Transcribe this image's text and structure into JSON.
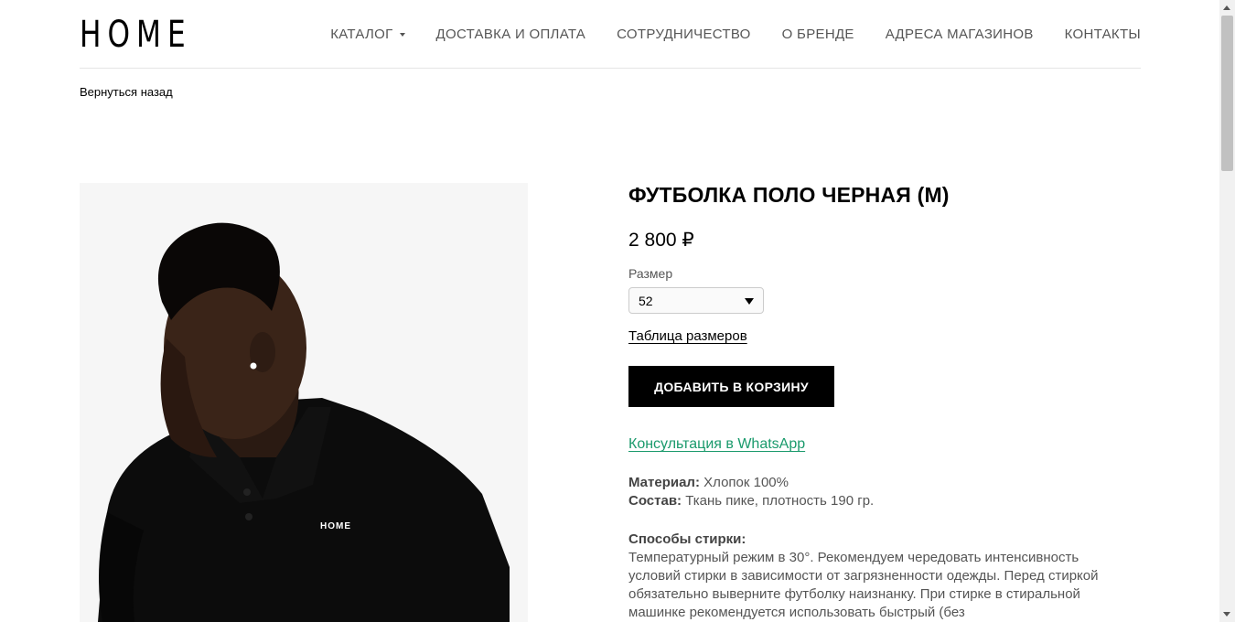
{
  "header": {
    "logo": "HOME",
    "nav": [
      {
        "label": "КАТАЛОГ",
        "has_dropdown": true
      },
      {
        "label": "ДОСТАВКА И ОПЛАТА"
      },
      {
        "label": "СОТРУДНИЧЕСТВО"
      },
      {
        "label": "О БРЕНДЕ"
      },
      {
        "label": "АДРЕСА МАГАЗИНОВ"
      },
      {
        "label": "КОНТАКТЫ"
      }
    ]
  },
  "back_link": "Вернуться назад",
  "product": {
    "title": "ФУТБОЛКА ПОЛО ЧЕРНАЯ (М)",
    "price": "2 800 ₽",
    "size_label": "Размер",
    "size_value": "52",
    "size_table_link": "Таблица размеров",
    "add_to_cart": "ДОБАВИТЬ В КОРЗИНУ",
    "whatsapp_link": "Консультация в WhatsApp",
    "material_label": "Материал:",
    "material_value": "Хлопок 100%",
    "composition_label": "Состав:",
    "composition_value": "Ткань пике, плотность 190 гр.",
    "wash_title": "Способы стирки:",
    "wash_text": "Температурный режим в 30°. Рекомендуем чередовать интенсивность условий стирки в зависимости от загрязненности одежды. Перед стиркой обязательно выверните футболку наизнанку. При стирке в стиральной машинке рекомендуется использовать быстрый (без",
    "shirt_logo": "HOME"
  },
  "colors": {
    "accent_link": "#1a9a6c",
    "button_bg": "#000000",
    "nav_text": "#555555"
  }
}
